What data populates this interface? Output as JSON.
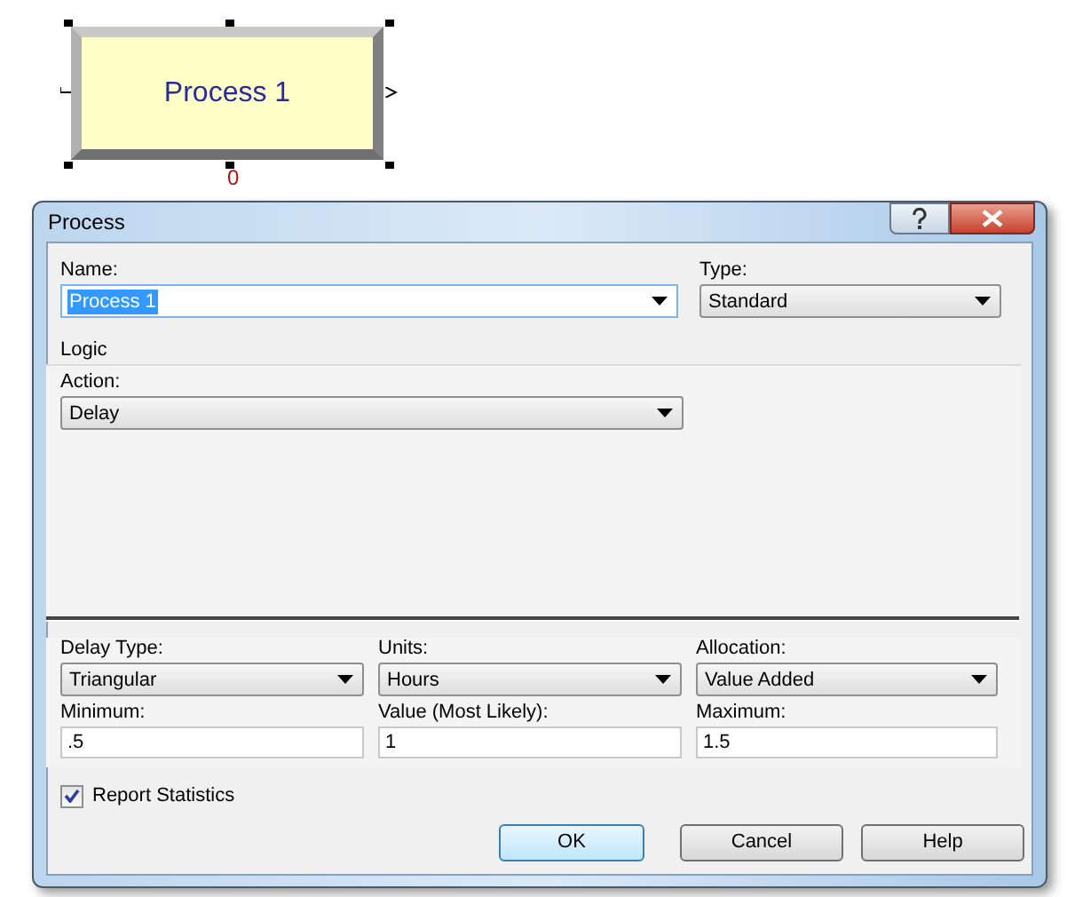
{
  "module": {
    "label": "Process 1",
    "counter": "0"
  },
  "dialog": {
    "title": "Process"
  },
  "name": {
    "label": "Name:",
    "value": "Process 1",
    "text_selected": true
  },
  "type": {
    "label": "Type:",
    "value": "Standard"
  },
  "logic": {
    "title": "Logic",
    "action": {
      "label": "Action:",
      "value": "Delay"
    }
  },
  "delay": [
    {
      "label": "Delay Type:",
      "value": "Triangular"
    },
    {
      "label": "Units:",
      "value": "Hours"
    },
    {
      "label": "Allocation:",
      "value": "Value Added"
    }
  ],
  "params": [
    {
      "label": "Minimum:",
      "value": ".5"
    },
    {
      "label": "Value (Most Likely):",
      "value": "1"
    },
    {
      "label": "Maximum:",
      "value": "1.5"
    }
  ],
  "report_statistics": {
    "label": "Report Statistics",
    "checked": true
  },
  "buttons": [
    {
      "label": "OK",
      "default": true
    },
    {
      "label": "Cancel",
      "default": false
    },
    {
      "label": "Help",
      "default": false
    }
  ]
}
